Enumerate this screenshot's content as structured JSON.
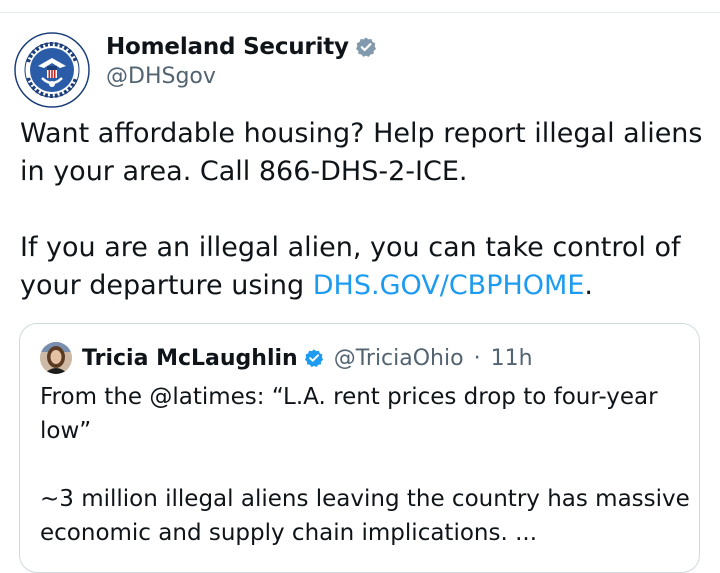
{
  "tweet": {
    "author": {
      "display_name": "Homeland Security",
      "handle": "@DHSgov",
      "verified_icon": "verified-badge-gray",
      "avatar_icon": "dhs-seal"
    },
    "text_line1": "Want affordable housing? Help report illegal aliens in your area. Call 866-DHS-2-ICE.",
    "text_line2_prefix": "If you are an illegal alien, you can take control of your departure using ",
    "text_line2_link": "DHS.GOV/CBPHOME",
    "text_line2_suffix": ".",
    "link_color": "#1d9bf0"
  },
  "quote": {
    "author": {
      "display_name": "Tricia McLaughlin",
      "handle": "@TriciaOhio",
      "separator": "·",
      "time": "11h",
      "verified_icon": "verified-badge-blue",
      "avatar_icon": "profile-photo"
    },
    "text_para1": "From the @latimes: “L.A. rent prices drop to four-year low”",
    "text_para2": "~3 million illegal aliens leaving the country has massive economic and supply chain implications.  ..."
  }
}
